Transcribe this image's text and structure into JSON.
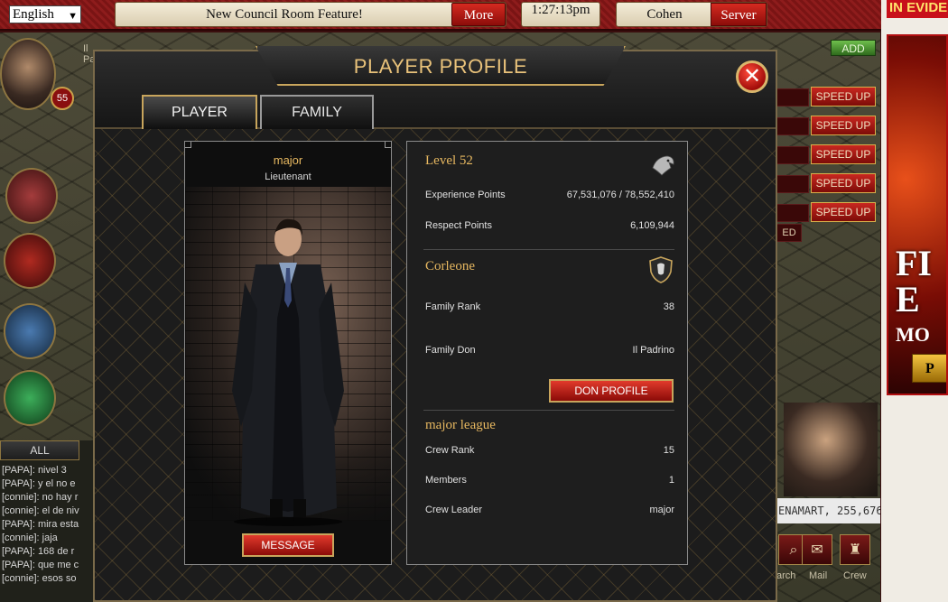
{
  "topbar": {
    "language": "English",
    "news_text": "New Council Room Feature!",
    "more_label": "More",
    "clock": "1:27:13pm",
    "server_name": "Cohen",
    "server_label": "Server"
  },
  "ad": {
    "header_text": "IN EVIDE",
    "big_text": "FI E",
    "small_text": "MO",
    "button_text": "P"
  },
  "sidebar": {
    "level": "55",
    "owner_label": "Il Padrino"
  },
  "chat": {
    "tab_label": "ALL",
    "lines": [
      "[PAPA]: nivel 3",
      "[PAPA]: y el no e",
      "[connie]: no hay r",
      "[connie]: el de niv",
      "[PAPA]: mira esta",
      "[connie]: jaja",
      "[PAPA]: 168 de r",
      "[PAPA]: que me c",
      "[connie]: esos so"
    ]
  },
  "right_panel": {
    "add_label": "ADD",
    "speed_up_label": "SPEED UP",
    "partial_label": "ED",
    "ticker_text": "ENAMART, 255,676",
    "nav": [
      {
        "label": "arch",
        "icon": "search-icon"
      },
      {
        "label": "Mail",
        "icon": "mail-icon"
      },
      {
        "label": "Crew",
        "icon": "crew-icon"
      }
    ]
  },
  "modal": {
    "title": "PLAYER PROFILE",
    "tabs": [
      "PLAYER",
      "FAMILY"
    ],
    "player": {
      "name": "major",
      "rank": "Lieutenant",
      "message_label": "MESSAGE"
    },
    "stats": {
      "level": "Level 52",
      "xp_label": "Experience Points",
      "xp_value": "67,531,076 / 78,552,410",
      "respect_label": "Respect Points",
      "respect_value": "6,109,944"
    },
    "family": {
      "name": "Corleone",
      "rank_label": "Family Rank",
      "rank_value": "38",
      "don_label": "Family Don",
      "don_value": "Il Padrino",
      "don_button": "DON PROFILE"
    },
    "crew": {
      "name": "major league",
      "rank_label": "Crew Rank",
      "rank_value": "15",
      "members_label": "Members",
      "members_value": "1",
      "leader_label": "Crew Leader",
      "leader_value": "major"
    }
  },
  "colors": {
    "accent_gold": "#e7b860",
    "button_red": "#c82720",
    "topbar_red": "#8e1c1c"
  }
}
